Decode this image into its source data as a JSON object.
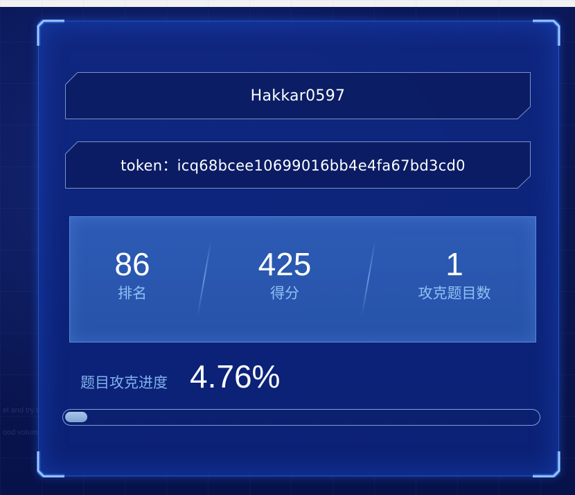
{
  "user": {
    "name": "Hakkar0597",
    "token_text": "token：icq68bcee10699016bb4e4fa67bd3cd0"
  },
  "stats": {
    "rank": {
      "value": "86",
      "label": "排名"
    },
    "score": {
      "value": "425",
      "label": "得分"
    },
    "solved": {
      "value": "1",
      "label": "攻克题目数"
    }
  },
  "progress": {
    "label": "题目攻克进度",
    "value_text": "4.76%",
    "fraction": 0.0476
  },
  "background_text": {
    "line1": "el and try to",
    "line2": "ood volum"
  },
  "colors": {
    "panel_bg": "#10288a",
    "accent_glow": "#3c78ff",
    "stat_label": "#8fc0f4",
    "progress_fill": "#a8c6ea"
  },
  "icons": [
    "corner-frame-icon"
  ]
}
